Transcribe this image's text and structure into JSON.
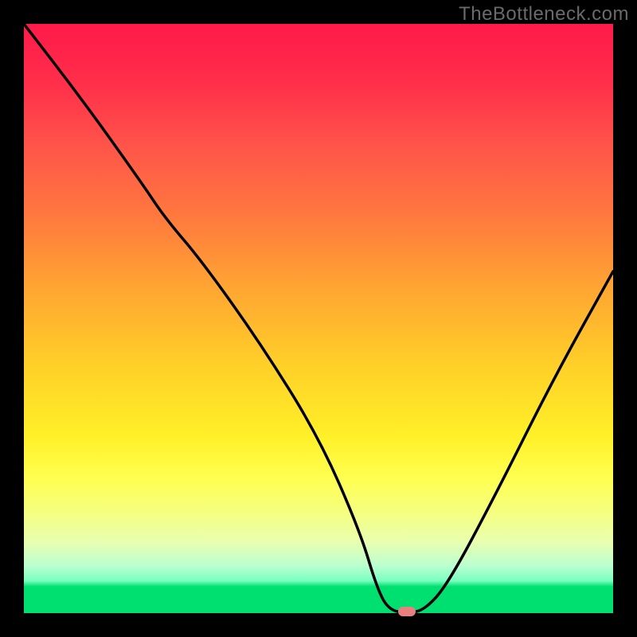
{
  "watermark": "TheBottleneck.com",
  "chart_data": {
    "type": "line",
    "title": "",
    "xlabel": "",
    "ylabel": "",
    "xlim": [
      0,
      100
    ],
    "ylim": [
      0,
      100
    ],
    "series": [
      {
        "name": "bottleneck-curve",
        "x": [
          0,
          10,
          20,
          24,
          30,
          40,
          50,
          57,
          60,
          62,
          65,
          68,
          72,
          80,
          90,
          100
        ],
        "y": [
          100,
          87,
          73,
          67,
          60,
          46,
          30,
          14,
          4,
          0.5,
          0,
          0.5,
          5,
          20,
          40,
          58
        ]
      }
    ],
    "marker": {
      "x": 65,
      "y": 0,
      "color": "#e88080"
    },
    "gradient_stops": [
      {
        "pos": 0,
        "color": "#ff1a4a"
      },
      {
        "pos": 0.1,
        "color": "#ff2e4a"
      },
      {
        "pos": 0.2,
        "color": "#ff524a"
      },
      {
        "pos": 0.33,
        "color": "#ff7a3e"
      },
      {
        "pos": 0.45,
        "color": "#ffa632"
      },
      {
        "pos": 0.58,
        "color": "#ffd028"
      },
      {
        "pos": 0.7,
        "color": "#fff028"
      },
      {
        "pos": 0.77,
        "color": "#ffff50"
      },
      {
        "pos": 0.83,
        "color": "#f5ff80"
      },
      {
        "pos": 0.88,
        "color": "#e8ffb0"
      },
      {
        "pos": 0.92,
        "color": "#baffd0"
      },
      {
        "pos": 0.945,
        "color": "#7affc0"
      },
      {
        "pos": 0.955,
        "color": "#00e070"
      },
      {
        "pos": 1.0,
        "color": "#00e070"
      }
    ]
  }
}
